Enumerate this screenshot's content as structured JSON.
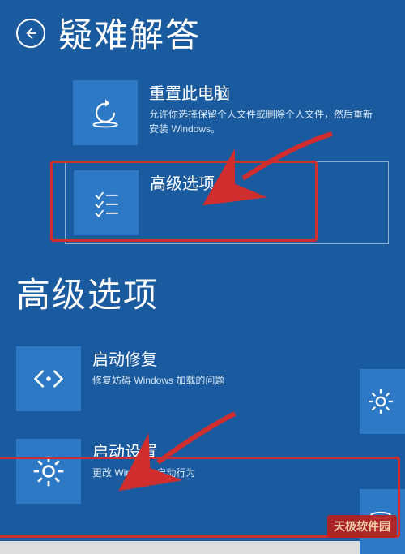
{
  "screens": {
    "troubleshoot": {
      "title": "疑难解答",
      "tiles": {
        "reset": {
          "title": "重置此电脑",
          "desc": "允许你选择保留个人文件或删除个人文件，然后重新安装 Windows。"
        },
        "advanced": {
          "title": "高级选项",
          "desc": ""
        }
      }
    },
    "advanced_options": {
      "title": "高级选项",
      "tiles": {
        "startup_repair": {
          "title": "启动修复",
          "desc": "修复妨碍 Windows 加载的问题"
        },
        "startup_settings": {
          "title": "启动设置",
          "desc": "更改 Windows 启动行为"
        }
      }
    }
  },
  "watermark": "天极软件园"
}
